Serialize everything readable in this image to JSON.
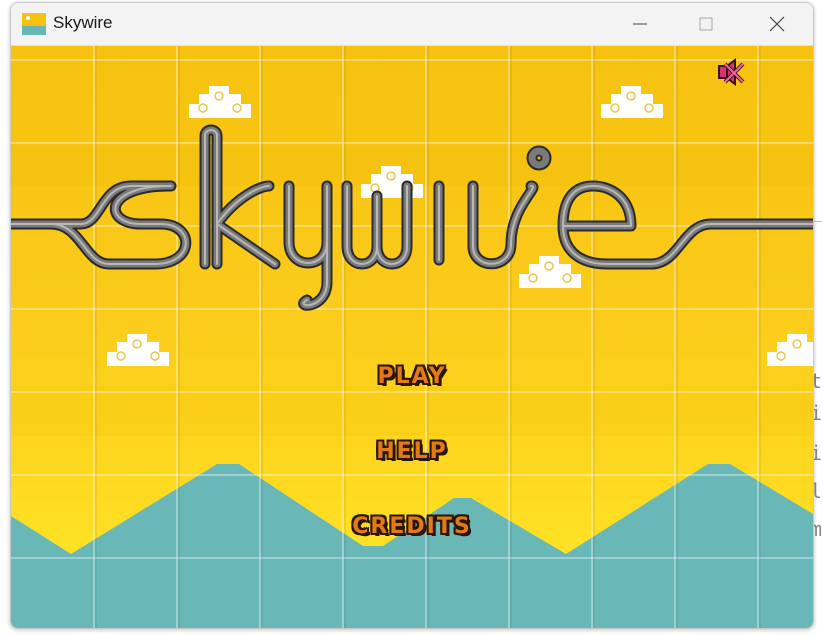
{
  "window": {
    "title": "Skywire"
  },
  "game": {
    "logo_text": "skywire",
    "menu": {
      "play": "PLAY",
      "help": "HELP",
      "credits": "CREDITS"
    },
    "mute_icon": "speaker-muted-icon"
  },
  "background_text": [
    "t",
    "i",
    "i",
    "l",
    "m"
  ],
  "colors": {
    "sky_top": "#f6c20f",
    "sky_bottom": "#ffe52a",
    "mountains": "#69b7b7",
    "wire": "#6b6b6b",
    "menu_text": "#e07b17",
    "menu_outline": "#2c1408"
  }
}
